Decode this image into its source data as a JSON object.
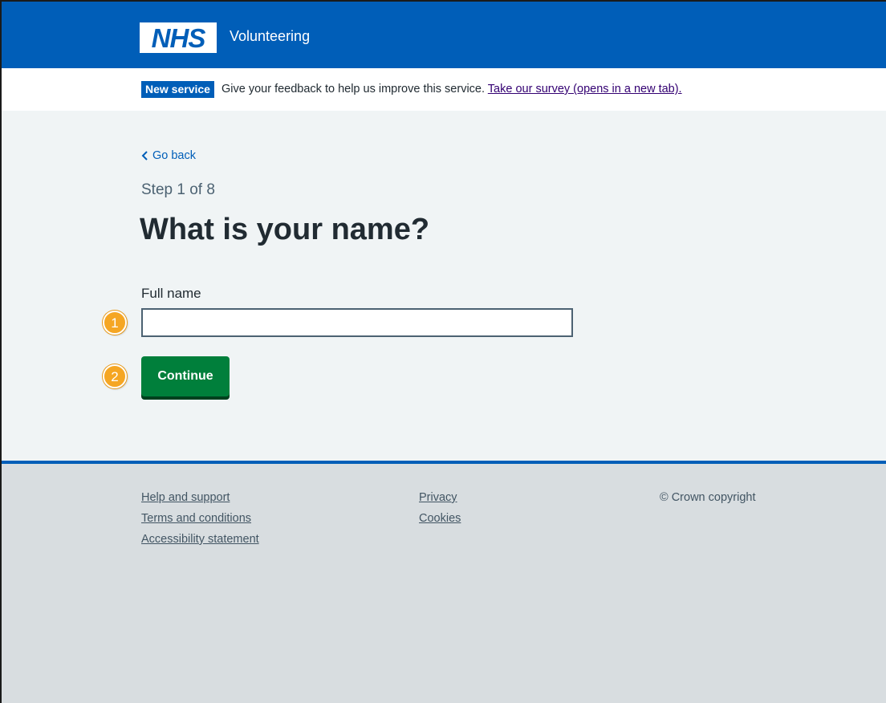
{
  "header": {
    "logo_text": "NHS",
    "service_name": "Volunteering",
    "brand_color": "#005eb8"
  },
  "banner": {
    "tag": "New service",
    "text": "Give your feedback to help us improve this service.",
    "link": "Take our survey (opens in a new tab)."
  },
  "main": {
    "back_link": "Go back",
    "step": "Step 1 of 8",
    "title": "What is your name?",
    "field_label": "Full name",
    "field_value": "",
    "button_label": "Continue",
    "button_color": "#007f3b",
    "markers": [
      "1",
      "2"
    ]
  },
  "footer": {
    "links_col1": [
      "Help and support",
      "Terms and conditions",
      "Accessibility statement"
    ],
    "links_col2": [
      "Privacy",
      "Cookies"
    ],
    "copyright": "© Crown copyright"
  }
}
